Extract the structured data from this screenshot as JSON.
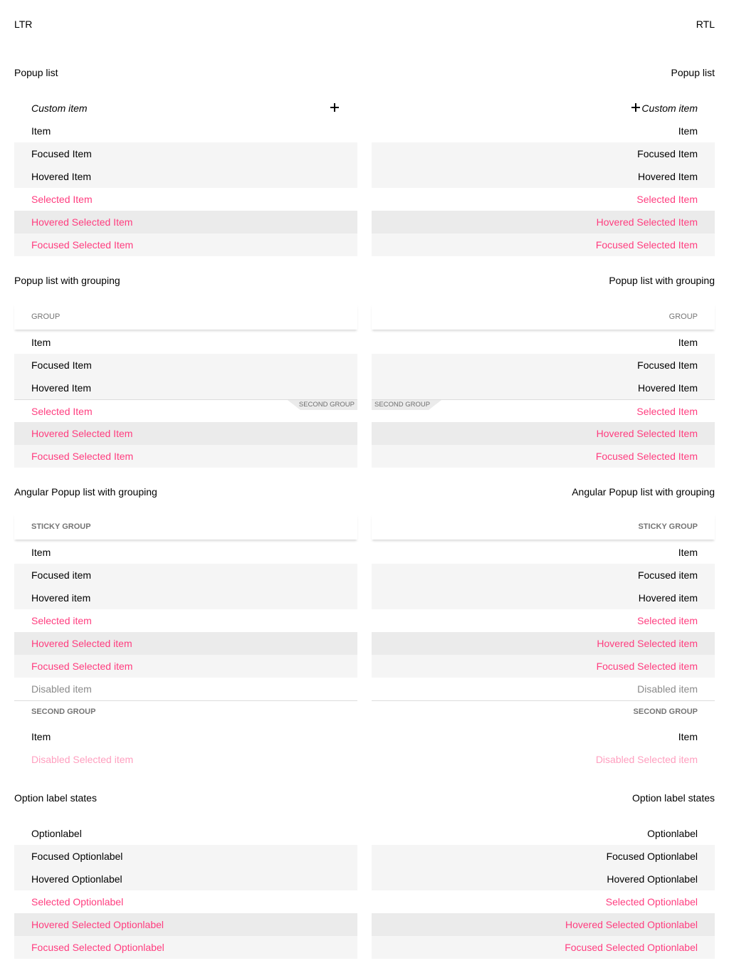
{
  "directions": {
    "ltr": "LTR",
    "rtl": "RTL"
  },
  "colors": {
    "accent": "#ff3d7f",
    "focused_bg": "#f5f5f5",
    "hovered_selected_bg": "#ebebeb",
    "muted_text": "#757575"
  },
  "icons": {
    "custom_item": "plus-icon"
  },
  "sections": {
    "popup": {
      "title": "Popup list",
      "custom_item": "Custom item",
      "items": [
        "Item",
        "Focused Item",
        "Hovered Item",
        "Selected Item",
        "Hovered Selected Item",
        "Focused Selected Item"
      ]
    },
    "grouping": {
      "title": "Popup list with grouping",
      "group": "GROUP",
      "second_group": "SECOND GROUP",
      "items": [
        "Item",
        "Focused Item",
        "Hovered Item",
        "Selected Item",
        "Hovered Selected Item",
        "Focused Selected Item"
      ]
    },
    "angular": {
      "title": "Angular Popup list with grouping",
      "sticky_group": "STICKY GROUP",
      "items": [
        "Item",
        "Focused item",
        "Hovered item",
        "Selected item",
        "Hovered Selected item",
        "Focused Selected item",
        "Disabled item"
      ],
      "second_group": "SECOND GROUP",
      "second_items": [
        "Item",
        "Disabled Selected item"
      ]
    },
    "option_label": {
      "title": "Option label states",
      "items": [
        "Optionlabel",
        "Focused Optionlabel",
        "Hovered Optionlabel",
        "Selected Optionlabel",
        "Hovered Selected Optionlabel",
        "Focused Selected Optionlabel"
      ]
    }
  }
}
